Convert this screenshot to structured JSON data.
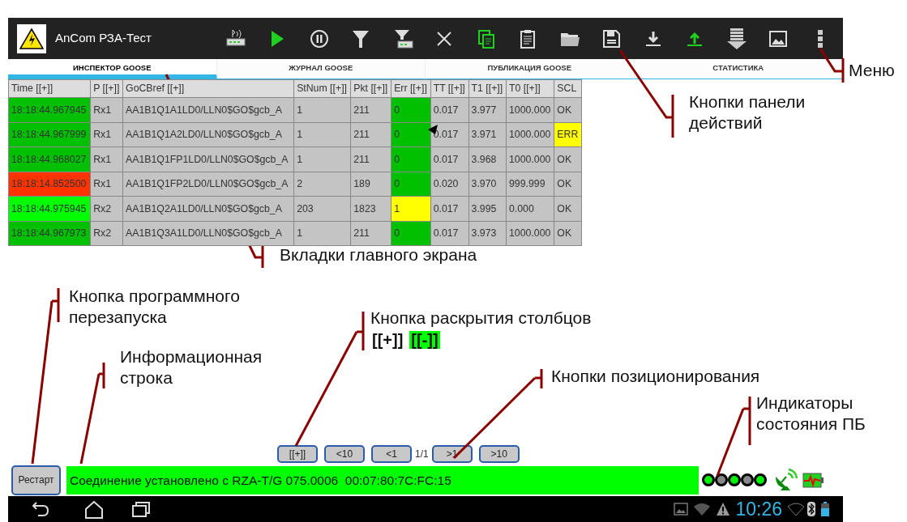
{
  "app": {
    "title": "AnCom РЗА-Тест"
  },
  "tabs": [
    {
      "label": "ИНСПЕКТОР GOOSE",
      "selected": true
    },
    {
      "label": "ЖУРНАЛ GOOSE",
      "selected": false
    },
    {
      "label": "ПУБЛИКАЦИЯ GOOSE",
      "selected": false
    },
    {
      "label": "СТАТИСТИКА",
      "selected": false
    }
  ],
  "table": {
    "columns": [
      "Time [[+]]",
      "P [[+]]",
      "GoCBref [[+]]",
      "StNum [[+]]",
      "Pkt [[+]]",
      "Err [[+]]",
      "TT [[+]]",
      "T1 [[+]]",
      "T0 [[+]]",
      "SCL"
    ],
    "rows": [
      [
        {
          "text": "18:18:44.967945",
          "color": "#00c000"
        },
        "Rx1",
        "AA1B1Q1A1LD0/LLN0$GO$gcb_A",
        "1",
        "211",
        {
          "text": "0",
          "color": "#00c000"
        },
        "0.017",
        "3.977",
        "1000.000",
        "OK"
      ],
      [
        {
          "text": "18:18:44.967999",
          "color": "#00c000"
        },
        "Rx1",
        "AA1B1Q1A2LD0/LLN0$GO$gcb_A",
        "1",
        "211",
        {
          "text": "0",
          "color": "#00c000"
        },
        "0.017",
        "3.971",
        "1000.000",
        {
          "text": "ERR",
          "color": "#ffff00"
        }
      ],
      [
        {
          "text": "18:18:44.968027",
          "color": "#00c000"
        },
        "Rx1",
        "AA1B1Q1FP1LD0/LLN0$GO$gcb_A",
        "1",
        "211",
        {
          "text": "0",
          "color": "#00c000"
        },
        "0.017",
        "3.968",
        "1000.000",
        "OK"
      ],
      [
        {
          "text": "18:18:14.852500",
          "color": "#ff3300"
        },
        "Rx1",
        "AA1B1Q1FP2LD0/LLN0$GO$gcb_A",
        "2",
        "189",
        {
          "text": "0",
          "color": "#00c000"
        },
        "0.020",
        "3.970",
        "999.999",
        "OK"
      ],
      [
        {
          "text": "18:18:44.975945",
          "color": "#00ff00"
        },
        "Rx2",
        "AA1B1Q2A1LD0/LLN0$GO$gcb_A",
        "203",
        "1823",
        {
          "text": "1",
          "color": "#ffff00"
        },
        "0.017",
        "3.995",
        "0.000",
        "OK"
      ],
      [
        {
          "text": "18:18:44.967973",
          "color": "#00c000"
        },
        "Rx2",
        "AA1B1Q3A1LD0/LLN0$GO$gcb_A",
        "1",
        "211",
        {
          "text": "0",
          "color": "#00c000"
        },
        "0.017",
        "3.973",
        "1000.000",
        "OK"
      ]
    ]
  },
  "pager": {
    "buttons": [
      "[[+]]",
      "<10",
      "<1"
    ],
    "page": "1/1",
    "buttons_after": [
      ">1",
      ">10"
    ]
  },
  "restart_button": "Рестарт",
  "info_line": "Соединение установлено с RZA-T/G 075.0006  00:07:80:7C:FC:15",
  "indicators": [
    {
      "on": true
    },
    {
      "on": false
    },
    {
      "on": true
    },
    {
      "on": false
    },
    {
      "on": true
    }
  ],
  "system_bar": {
    "clock": "10:26"
  },
  "annotations": [
    {
      "lines": [
        "Меню"
      ]
    },
    {
      "lines": [
        "Кнопки панели",
        "действий"
      ]
    },
    {
      "lines": [
        "Вкладки главного экрана"
      ]
    },
    {
      "lines": [
        "Кнопка программного",
        "перезапуска"
      ]
    },
    {
      "lines": [
        "Информационная",
        "строка"
      ]
    },
    {
      "lines": [
        "Кнопка раскрытия столбцов"
      ],
      "tokens": [
        {
          "text": "[[+]]",
          "highlighted": false
        },
        {
          "text": "[[-]]",
          "highlighted": true
        }
      ]
    },
    {
      "lines": [
        "Кнопки позиционирования"
      ]
    },
    {
      "lines": [
        "Индикаторы",
        "состояния ПБ"
      ]
    }
  ]
}
